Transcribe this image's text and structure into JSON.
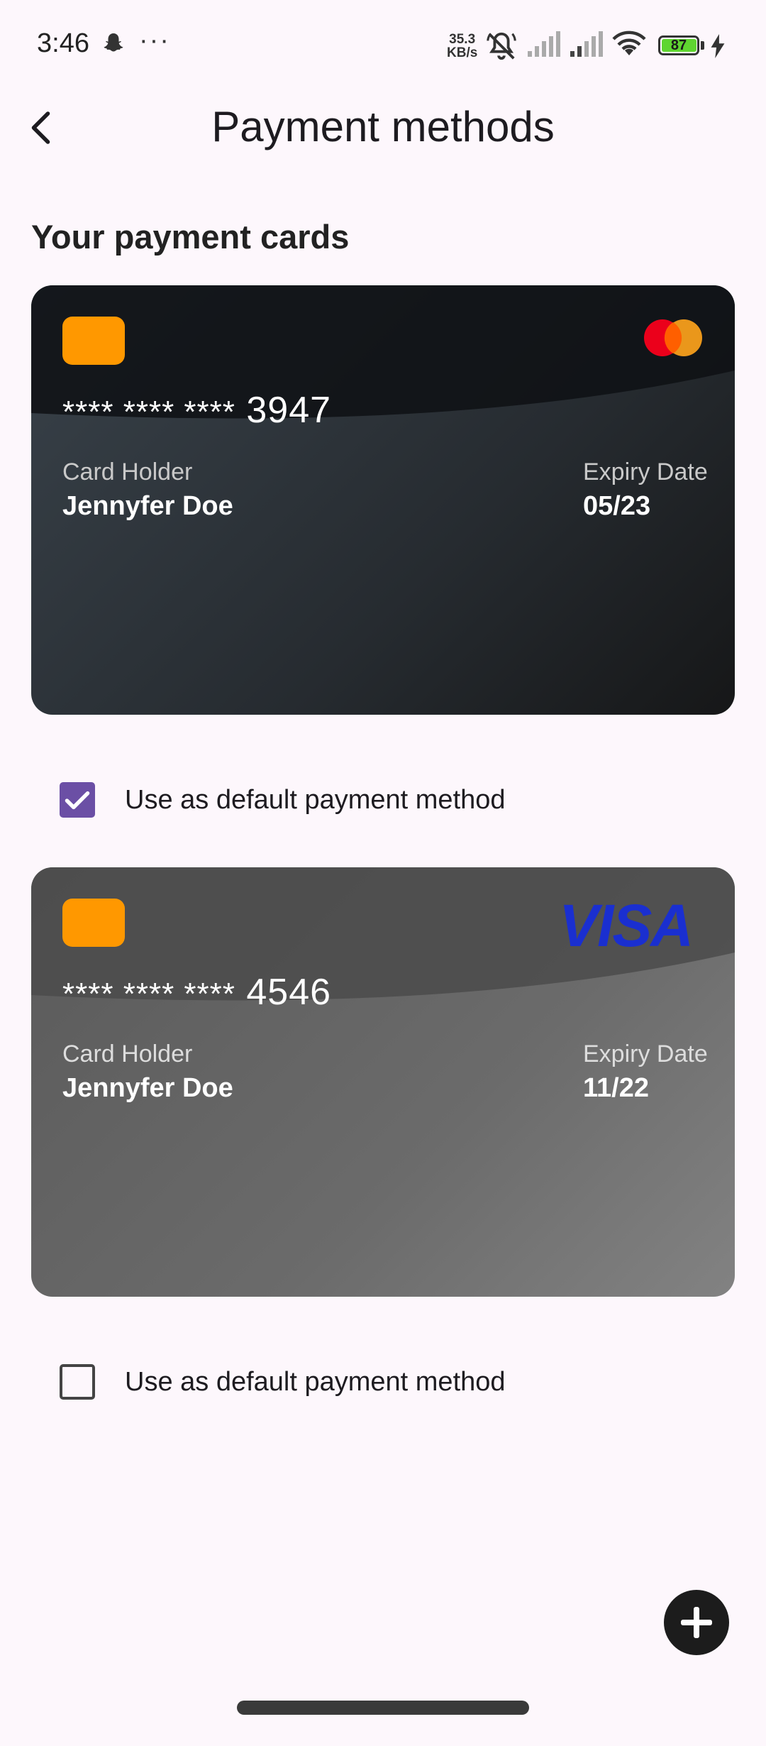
{
  "status_bar": {
    "time": "3:46",
    "dots": "···",
    "net_speed_value": "35.3",
    "net_speed_unit": "KB/s",
    "battery": "87",
    "icons": [
      "snapchat-icon",
      "mute-icon",
      "signal-icon",
      "signal-icon",
      "wifi-icon",
      "battery-icon",
      "charging-icon"
    ]
  },
  "app_bar": {
    "title": "Payment methods",
    "back_icon": "chevron-left-icon"
  },
  "section_title": "Your payment cards",
  "cards": [
    {
      "brand": "mastercard",
      "number_mask": "**** **** ****",
      "last4": "3947",
      "holder_label": "Card Holder",
      "holder_name": "Jennyfer Doe",
      "expiry_label": "Expiry Date",
      "expiry": "05/23",
      "default_label": "Use as default payment method",
      "is_default": true
    },
    {
      "brand": "visa",
      "brand_text": "VISA",
      "number_mask": "**** **** ****",
      "last4": "4546",
      "holder_label": "Card Holder",
      "holder_name": "Jennyfer Doe",
      "expiry_label": "Expiry Date",
      "expiry": "11/22",
      "default_label": "Use as default payment method",
      "is_default": false
    }
  ],
  "fab": {
    "icon": "plus-icon"
  },
  "colors": {
    "background": "#fdf7fc",
    "chip": "#ff9800",
    "checkbox_checked": "#6b4fa5",
    "visa_blue": "#1a2fd0",
    "mastercard_red": "#eb001b",
    "mastercard_orange": "#f79e1b"
  }
}
